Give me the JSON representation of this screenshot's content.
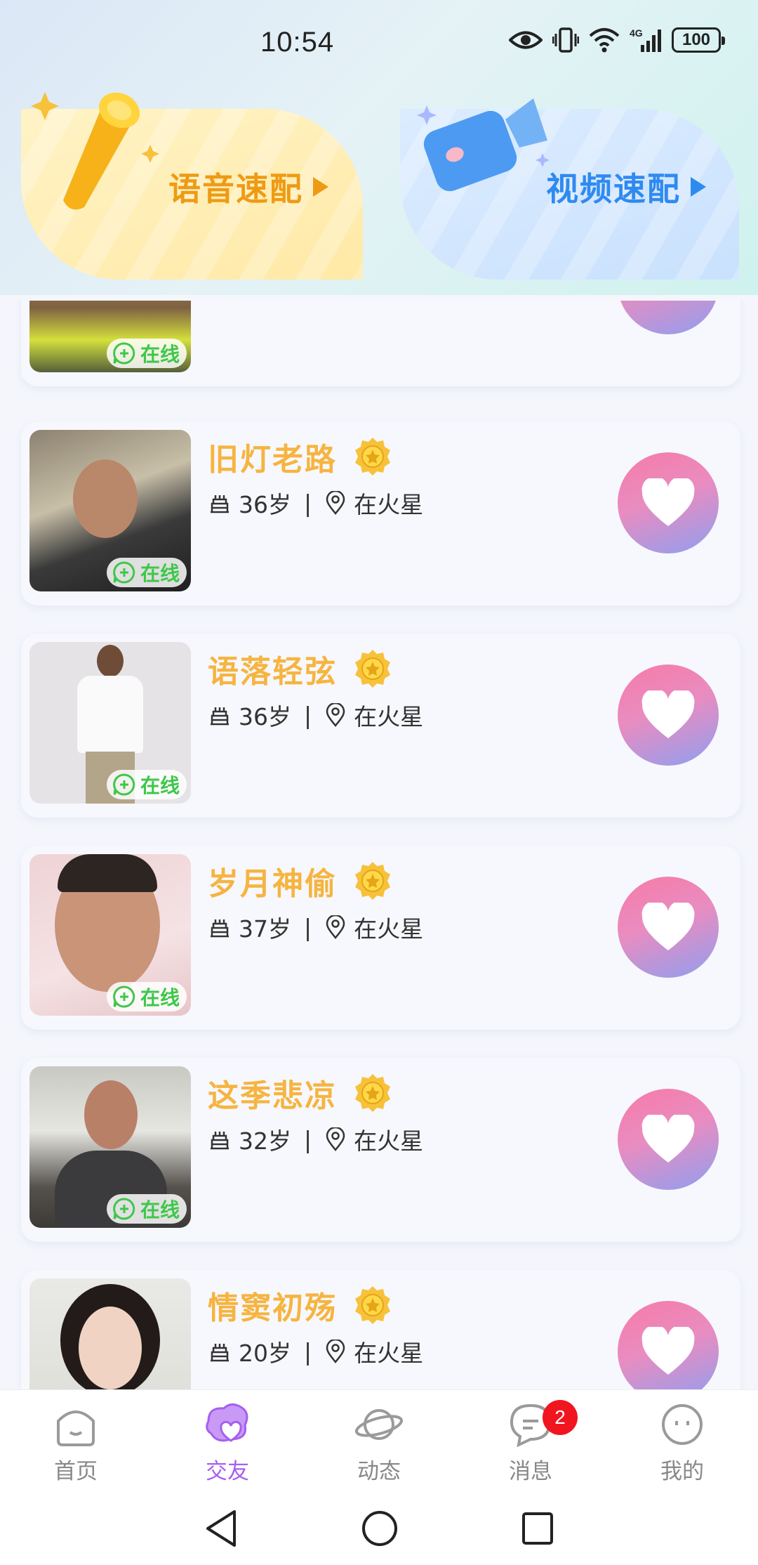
{
  "status_bar": {
    "time": "10:54",
    "battery": "100",
    "network": "4G"
  },
  "banners": {
    "voice": {
      "label": "语音速配"
    },
    "video": {
      "label": "视频速配"
    }
  },
  "online_label": "在线",
  "users": [
    {
      "name": "旧灯老路",
      "age": "36岁",
      "location": "在火星"
    },
    {
      "name": "语落轻弦",
      "age": "36岁",
      "location": "在火星"
    },
    {
      "name": "岁月神偷",
      "age": "37岁",
      "location": "在火星"
    },
    {
      "name": "这季悲凉",
      "age": "32岁",
      "location": "在火星"
    },
    {
      "name": "情窦初殇",
      "age": "20岁",
      "location": "在火星"
    }
  ],
  "tabbar": {
    "items": [
      {
        "label": "首页",
        "icon": "home-icon"
      },
      {
        "label": "交友",
        "icon": "friends-icon",
        "active": true
      },
      {
        "label": "动态",
        "icon": "planet-icon"
      },
      {
        "label": "消息",
        "icon": "message-icon",
        "badge": "2"
      },
      {
        "label": "我的",
        "icon": "profile-icon"
      }
    ]
  },
  "colors": {
    "accent_purple": "#a55ff0",
    "name_gold": "#f6b440",
    "online_green": "#3ec74a",
    "voice_orange": "#ee9b14",
    "video_blue": "#2f8af0"
  }
}
